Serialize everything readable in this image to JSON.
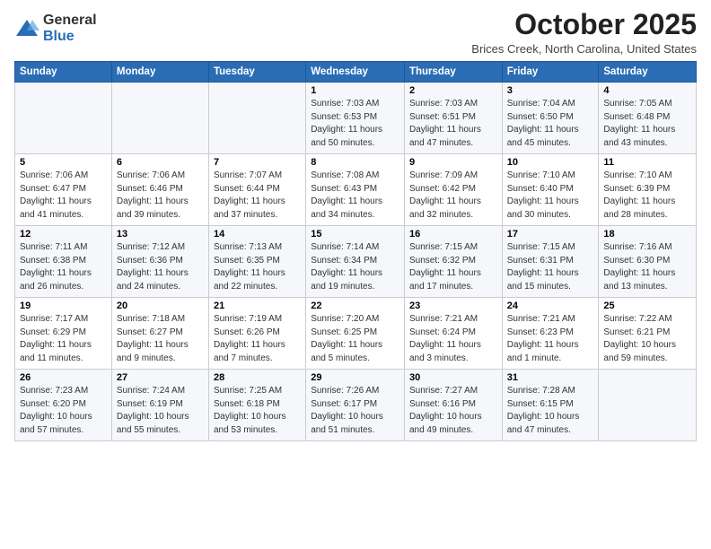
{
  "header": {
    "logo": {
      "general": "General",
      "blue": "Blue"
    },
    "month_title": "October 2025",
    "location": "Brices Creek, North Carolina, United States"
  },
  "days_of_week": [
    "Sunday",
    "Monday",
    "Tuesday",
    "Wednesday",
    "Thursday",
    "Friday",
    "Saturday"
  ],
  "weeks": [
    [
      {
        "day": "",
        "info": ""
      },
      {
        "day": "",
        "info": ""
      },
      {
        "day": "",
        "info": ""
      },
      {
        "day": "1",
        "info": "Sunrise: 7:03 AM\nSunset: 6:53 PM\nDaylight: 11 hours and 50 minutes."
      },
      {
        "day": "2",
        "info": "Sunrise: 7:03 AM\nSunset: 6:51 PM\nDaylight: 11 hours and 47 minutes."
      },
      {
        "day": "3",
        "info": "Sunrise: 7:04 AM\nSunset: 6:50 PM\nDaylight: 11 hours and 45 minutes."
      },
      {
        "day": "4",
        "info": "Sunrise: 7:05 AM\nSunset: 6:48 PM\nDaylight: 11 hours and 43 minutes."
      }
    ],
    [
      {
        "day": "5",
        "info": "Sunrise: 7:06 AM\nSunset: 6:47 PM\nDaylight: 11 hours and 41 minutes."
      },
      {
        "day": "6",
        "info": "Sunrise: 7:06 AM\nSunset: 6:46 PM\nDaylight: 11 hours and 39 minutes."
      },
      {
        "day": "7",
        "info": "Sunrise: 7:07 AM\nSunset: 6:44 PM\nDaylight: 11 hours and 37 minutes."
      },
      {
        "day": "8",
        "info": "Sunrise: 7:08 AM\nSunset: 6:43 PM\nDaylight: 11 hours and 34 minutes."
      },
      {
        "day": "9",
        "info": "Sunrise: 7:09 AM\nSunset: 6:42 PM\nDaylight: 11 hours and 32 minutes."
      },
      {
        "day": "10",
        "info": "Sunrise: 7:10 AM\nSunset: 6:40 PM\nDaylight: 11 hours and 30 minutes."
      },
      {
        "day": "11",
        "info": "Sunrise: 7:10 AM\nSunset: 6:39 PM\nDaylight: 11 hours and 28 minutes."
      }
    ],
    [
      {
        "day": "12",
        "info": "Sunrise: 7:11 AM\nSunset: 6:38 PM\nDaylight: 11 hours and 26 minutes."
      },
      {
        "day": "13",
        "info": "Sunrise: 7:12 AM\nSunset: 6:36 PM\nDaylight: 11 hours and 24 minutes."
      },
      {
        "day": "14",
        "info": "Sunrise: 7:13 AM\nSunset: 6:35 PM\nDaylight: 11 hours and 22 minutes."
      },
      {
        "day": "15",
        "info": "Sunrise: 7:14 AM\nSunset: 6:34 PM\nDaylight: 11 hours and 19 minutes."
      },
      {
        "day": "16",
        "info": "Sunrise: 7:15 AM\nSunset: 6:32 PM\nDaylight: 11 hours and 17 minutes."
      },
      {
        "day": "17",
        "info": "Sunrise: 7:15 AM\nSunset: 6:31 PM\nDaylight: 11 hours and 15 minutes."
      },
      {
        "day": "18",
        "info": "Sunrise: 7:16 AM\nSunset: 6:30 PM\nDaylight: 11 hours and 13 minutes."
      }
    ],
    [
      {
        "day": "19",
        "info": "Sunrise: 7:17 AM\nSunset: 6:29 PM\nDaylight: 11 hours and 11 minutes."
      },
      {
        "day": "20",
        "info": "Sunrise: 7:18 AM\nSunset: 6:27 PM\nDaylight: 11 hours and 9 minutes."
      },
      {
        "day": "21",
        "info": "Sunrise: 7:19 AM\nSunset: 6:26 PM\nDaylight: 11 hours and 7 minutes."
      },
      {
        "day": "22",
        "info": "Sunrise: 7:20 AM\nSunset: 6:25 PM\nDaylight: 11 hours and 5 minutes."
      },
      {
        "day": "23",
        "info": "Sunrise: 7:21 AM\nSunset: 6:24 PM\nDaylight: 11 hours and 3 minutes."
      },
      {
        "day": "24",
        "info": "Sunrise: 7:21 AM\nSunset: 6:23 PM\nDaylight: 11 hours and 1 minute."
      },
      {
        "day": "25",
        "info": "Sunrise: 7:22 AM\nSunset: 6:21 PM\nDaylight: 10 hours and 59 minutes."
      }
    ],
    [
      {
        "day": "26",
        "info": "Sunrise: 7:23 AM\nSunset: 6:20 PM\nDaylight: 10 hours and 57 minutes."
      },
      {
        "day": "27",
        "info": "Sunrise: 7:24 AM\nSunset: 6:19 PM\nDaylight: 10 hours and 55 minutes."
      },
      {
        "day": "28",
        "info": "Sunrise: 7:25 AM\nSunset: 6:18 PM\nDaylight: 10 hours and 53 minutes."
      },
      {
        "day": "29",
        "info": "Sunrise: 7:26 AM\nSunset: 6:17 PM\nDaylight: 10 hours and 51 minutes."
      },
      {
        "day": "30",
        "info": "Sunrise: 7:27 AM\nSunset: 6:16 PM\nDaylight: 10 hours and 49 minutes."
      },
      {
        "day": "31",
        "info": "Sunrise: 7:28 AM\nSunset: 6:15 PM\nDaylight: 10 hours and 47 minutes."
      },
      {
        "day": "",
        "info": ""
      }
    ]
  ]
}
